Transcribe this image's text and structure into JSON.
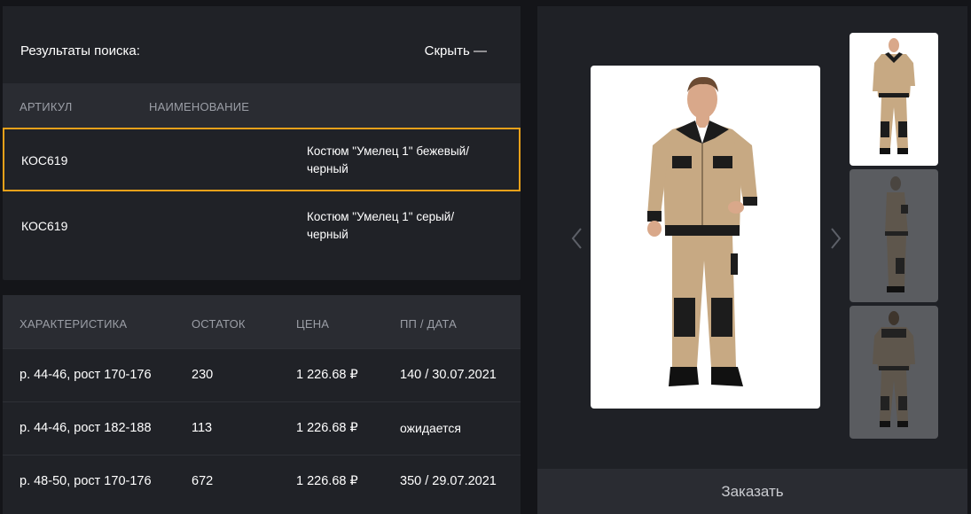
{
  "search": {
    "title": "Результаты поиска:",
    "hide_label": "Скрыть —",
    "columns": [
      "АРТИКУЛ",
      "НАИМЕНОВАНИЕ"
    ],
    "results": [
      {
        "article": "КОС619",
        "name": "Костюм \"Умелец 1\" бежевый/ черный",
        "selected": true
      },
      {
        "article": "КОС619",
        "name": "Костюм \"Умелец 1\" серый/ черный",
        "selected": false
      }
    ]
  },
  "stock": {
    "columns": [
      "ХАРАКТЕРИСТИКА",
      "ОСТАТОК",
      "ЦЕНА",
      "ПП / ДАТА"
    ],
    "rows": [
      {
        "characteristic": "р. 44-46, рост 170-176",
        "stock": "230",
        "price": "1 226.68 ₽",
        "pp_date": "140 / 30.07.2021"
      },
      {
        "characteristic": "р. 44-46, рост 182-188",
        "stock": "113",
        "price": "1 226.68 ₽",
        "pp_date": "ожидается"
      },
      {
        "characteristic": "р. 48-50, рост 170-176",
        "stock": "672",
        "price": "1 226.68 ₽",
        "pp_date": "350 / 29.07.2021"
      }
    ]
  },
  "gallery": {
    "order_label": "Заказать",
    "colors": {
      "beige": "#c7a983",
      "black": "#1c1c1c",
      "accent": "#e8a11a"
    }
  }
}
